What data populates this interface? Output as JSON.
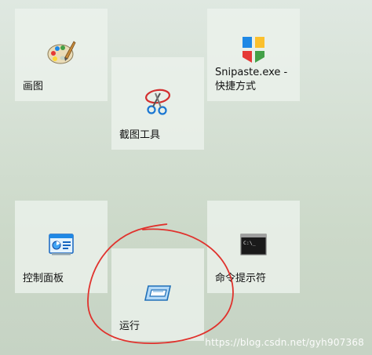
{
  "tiles": {
    "paint": {
      "label": "画图",
      "icon": "paint-palette-icon"
    },
    "snipaste": {
      "label": "Snipaste.exe -\n快捷方式",
      "icon": "snipaste-logo-icon"
    },
    "snipping_tool": {
      "label": "截图工具",
      "icon": "scissors-icon"
    },
    "control_panel": {
      "label": "控制面板",
      "icon": "control-panel-icon"
    },
    "command_prompt": {
      "label": "命令提示符",
      "icon": "terminal-icon"
    },
    "run": {
      "label": "运行",
      "icon": "run-dialog-icon"
    }
  },
  "annotation": {
    "shape": "hand-drawn-circle",
    "color": "#e0322d",
    "target": "run"
  },
  "watermark": "https://blog.csdn.net/gyh907368",
  "colors": {
    "background": "#d4dfd3",
    "tile": "#ecf2ec",
    "text": "#111111"
  }
}
